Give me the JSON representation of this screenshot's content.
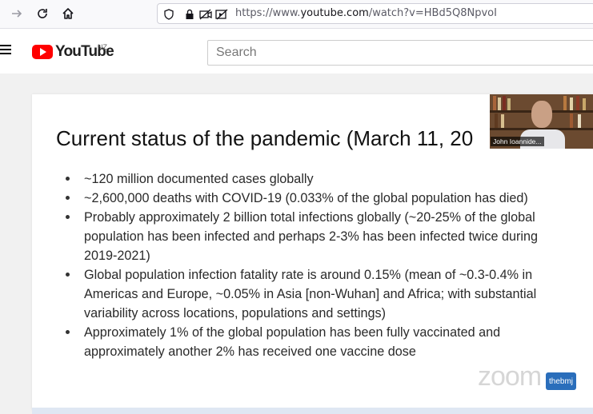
{
  "browser": {
    "url_prefix": "https://www.",
    "url_domain": "youtube.com",
    "url_suffix": "/watch?v=HBd5Q8NpvoI"
  },
  "youtube": {
    "logo_text": "YouTube",
    "country": "NZ",
    "search_placeholder": "Search"
  },
  "slide": {
    "title": "Current status of the pandemic (March 11, 20",
    "bullets": [
      "~120 million documented cases globally",
      "~2,600,000 deaths with COVID-19 (0.033% of the global population has died)",
      "Probably approximately 2 billion total infections globally (~20-25% of the global population has been infected and perhaps 2-3% has been infected twice during 2019-2021)",
      "Global population infection fatality rate is around 0.15% (mean of ~0.3-0.4% in Americas and Europe, ~0.05% in Asia [non-Wuhan] and Africa; with substantial variability across locations, populations and settings)",
      "Approximately 1% of the global population has been fully vaccinated and approximately another 2% has received one vaccine dose"
    ]
  },
  "speaker": {
    "name": "John Ioannide..."
  },
  "watermarks": {
    "zoom": "zoom",
    "bmj": "thebmj"
  },
  "colors": {
    "youtube_red": "#ff0000",
    "bmj_blue": "#2a6ebb"
  },
  "icons": {
    "forward": "arrow-right-icon",
    "reload": "reload-icon",
    "home": "home-icon",
    "shield": "shield-icon",
    "lock": "lock-icon",
    "permissions": "camera-blocked-icon",
    "autoplay": "autoplay-blocked-icon",
    "menu": "hamburger-menu-icon"
  }
}
